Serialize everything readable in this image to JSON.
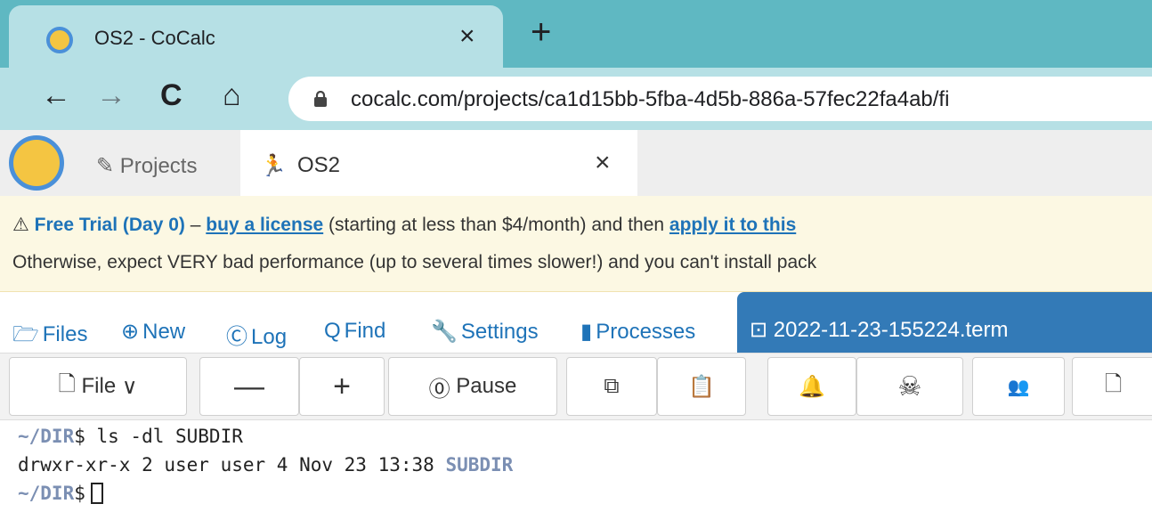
{
  "browser": {
    "tab_title": "OS2 - CoCalc",
    "tab_close": "×",
    "new_tab": "+",
    "back": "←",
    "forward": "→",
    "reload": "C",
    "home": "⌂",
    "url": "cocalc.com/projects/ca1d15bb-5fba-4d5b-886a-57fec22fa4ab/fi"
  },
  "appnav": {
    "projects_icon": "✎",
    "projects_label": "Projects",
    "project_tab_icon": "🏃",
    "project_tab_label": "OS2",
    "project_tab_close": "×"
  },
  "banner": {
    "warning_icon": "⚠",
    "trial_label": "Free Trial (Day 0)",
    "dash": " – ",
    "buy_link": "buy a license",
    "mid_text": " (starting at less than $4/month) and then ",
    "apply_link": "apply it to this",
    "line2": "Otherwise, expect VERY bad performance (up to several times slower!) and you can't install pack"
  },
  "project_toolbar": {
    "items": [
      {
        "icon": "🗁",
        "label": "Files"
      },
      {
        "icon": "⊕",
        "label": "New"
      },
      {
        "icon": "Ⓒ",
        "label": "Log"
      },
      {
        "icon": "Q",
        "label": "Find"
      },
      {
        "icon": "🔧",
        "label": "Settings"
      },
      {
        "icon": "▮",
        "label": "Processes"
      }
    ],
    "file_tab_icon": "⊡",
    "file_tab_label": "2022-11-23-155224.term"
  },
  "terminal_toolbar": {
    "file_icon": "🗋",
    "file_label": "File",
    "file_chevron": "∨",
    "minus": "—",
    "plus": "+",
    "pause_icon": "⓪",
    "pause_label": "Pause",
    "copy_icon": "⧉",
    "paste_icon": "📋",
    "bell_icon": "🔔",
    "kill_icon": "☠",
    "users_icon": "👥",
    "save_icon": "🗋"
  },
  "terminal": {
    "lines": [
      {
        "prompt": "~/DIR",
        "text": "$ ls -dl SUBDIR"
      },
      {
        "text": "drwxr-xr-x 2 user user 4 Nov 23 13:38 ",
        "dir": "SUBDIR"
      },
      {
        "prompt": "~/DIR",
        "text": "$"
      }
    ]
  }
}
